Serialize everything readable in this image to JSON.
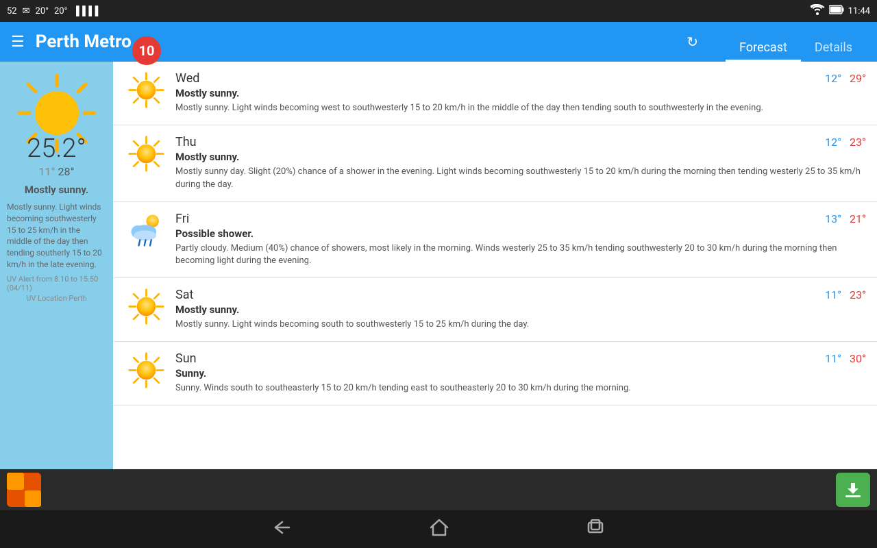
{
  "statusBar": {
    "left": [
      "52",
      "✉",
      "20°",
      "20°",
      "▐▐▐▐"
    ],
    "time": "11:44",
    "wifi": "wifi",
    "battery": "battery"
  },
  "header": {
    "title": "Perth Metro",
    "tabs": [
      {
        "label": "Forecast",
        "active": true
      },
      {
        "label": "Details",
        "active": false
      }
    ],
    "refreshLabel": "↻"
  },
  "current": {
    "temp": "25.2°",
    "low": "11°",
    "high": "28°",
    "desc": "Mostly sunny.",
    "detail": "Mostly sunny. Light winds becoming southwesterly 15 to 25 km/h in the middle of the day then tending southerly 15 to 20 km/h in the late evening.",
    "uvAlert": "UV Alert from 8.10 to 15.50 (04/11)",
    "uvLocation": "UV Location Perth",
    "uvIndex": "10"
  },
  "forecast": [
    {
      "day": "Wed",
      "icon": "sunny",
      "title": "Mostly sunny.",
      "desc": "Mostly sunny. Light winds becoming west to southwesterly 15 to 20 km/h in the middle of the day then tending south to southwesterly in the evening.",
      "low": "12°",
      "high": "29°"
    },
    {
      "day": "Thu",
      "icon": "sunny",
      "title": "Mostly sunny.",
      "desc": "Mostly sunny day. Slight (20%) chance of a shower in the evening. Light winds becoming southwesterly 15 to 20 km/h during the morning then tending westerly 25 to 35 km/h during the day.",
      "low": "12°",
      "high": "23°"
    },
    {
      "day": "Fri",
      "icon": "shower",
      "title": "Possible shower.",
      "desc": "Partly cloudy. Medium (40%) chance of showers, most likely in the morning. Winds westerly 25 to 35 km/h tending southwesterly 20 to 30 km/h during the morning then becoming light during the evening.",
      "low": "13°",
      "high": "21°"
    },
    {
      "day": "Sat",
      "icon": "sunny",
      "title": "Mostly sunny.",
      "desc": "Mostly sunny. Light winds becoming south to southwesterly 15 to 25 km/h during the day.",
      "low": "11°",
      "high": "23°"
    },
    {
      "day": "Sun",
      "icon": "sunny",
      "title": "Sunny.",
      "desc": "Sunny. Winds south to southeasterly 15 to 20 km/h tending east to southeasterly 20 to 30 km/h during the morning.",
      "low": "11°",
      "high": "30°"
    }
  ],
  "navBar": {
    "back": "←",
    "home": "⌂",
    "recents": "▭"
  }
}
